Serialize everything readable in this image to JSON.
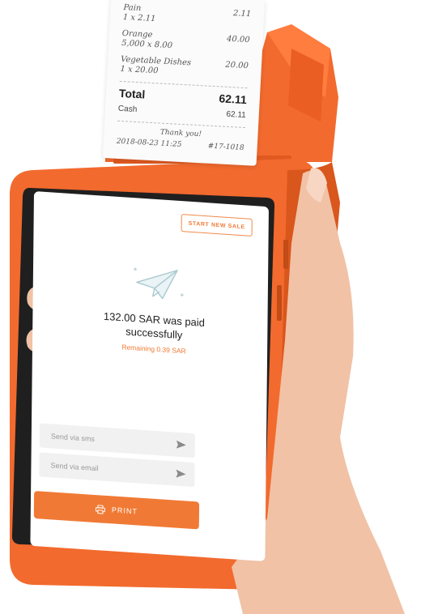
{
  "receipt": {
    "item1_name": "Pain",
    "item1_qty": "1 x 2.11",
    "item1_total": "2.11",
    "item2_name": "Orange",
    "item2_qty": "5,000 x 8.00",
    "item2_total": "40.00",
    "item3_name": "Vegetable Dishes",
    "item3_qty": "1 x 20.00",
    "item3_total": "20.00",
    "total_label": "Total",
    "total_value": "62.11",
    "cash_label": "Cash",
    "cash_value": "62.11",
    "thanks": "Thank you!",
    "datetime": "2018-08-23 11:25",
    "receipt_no": "#17-1018"
  },
  "screen": {
    "start_new_sale": "START NEW SALE",
    "paid_line1": "132.00 SAR was paid",
    "paid_line2": "successfully",
    "remaining": "Remaining 0.39 SAR",
    "sms_placeholder": "Send via sms",
    "email_placeholder": "Send via email",
    "print_label": "PRINT"
  },
  "colors": {
    "device_orange": "#f26a2e",
    "accent_orange": "#f07a35",
    "screen_bezel": "#1f1f1f",
    "field_bg": "#f1f1f1"
  },
  "icons": [
    "paper-plane-icon",
    "send-icon",
    "printer-icon"
  ]
}
